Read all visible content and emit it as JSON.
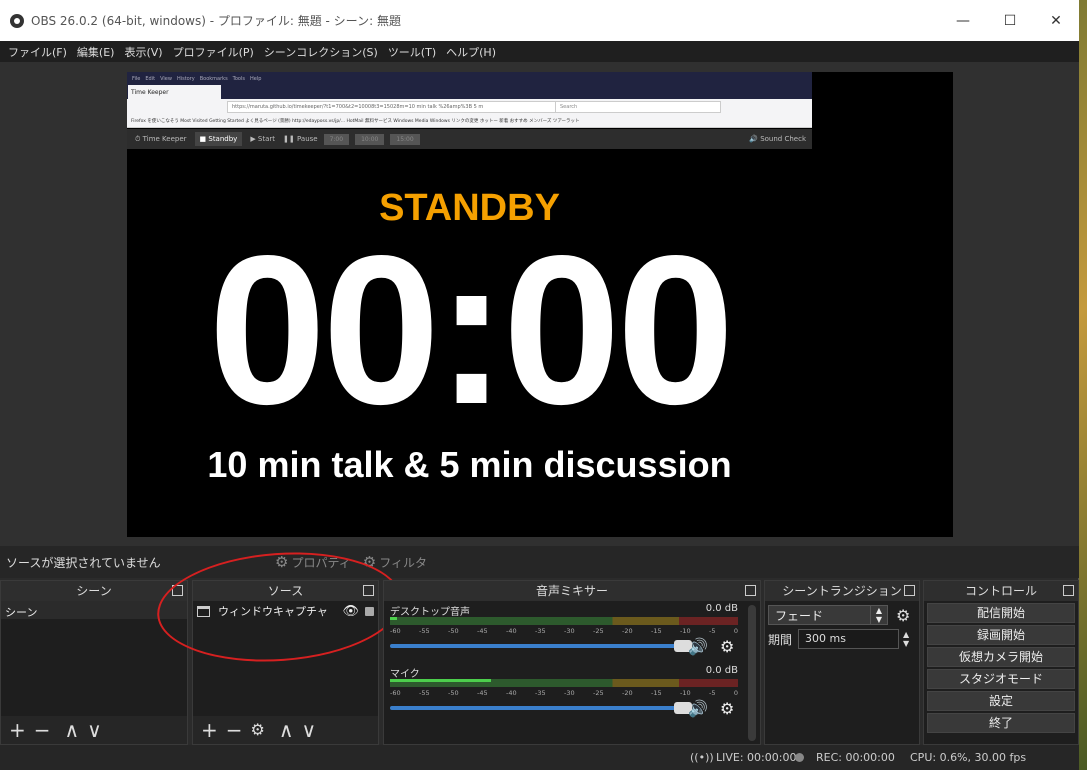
{
  "window": {
    "title": "OBS 26.0.2 (64-bit, windows) - プロファイル: 無題 - シーン: 無題",
    "minimize": "—",
    "maximize": "☐",
    "close": "✕"
  },
  "menu": [
    "ファイル(F)",
    "編集(E)",
    "表示(V)",
    "プロファイル(P)",
    "シーンコレクション(S)",
    "ツール(T)",
    "ヘルプ(H)"
  ],
  "preview": {
    "browser": {
      "menu": [
        "File",
        "Edit",
        "View",
        "History",
        "Bookmarks",
        "Tools",
        "Help"
      ],
      "tab": "Time Keeper",
      "url": "https://maruta.github.io/timekeeper/?t1=700&t2=10008t3=15028m=10 min talk %26amp%3B 5 m",
      "search_placeholder": "Search",
      "bookmarks": "Firefox を使いこなそう  Most Visited  Getting Started  よく見るページ  (景勝)  http://edayposs.vs/jp/...  HotMail 無料サービス  Windows Media  Windows  リンクの変更  ホットー  新着  おすすめ  メンバーズ  ツアーラット"
    },
    "timekeeper": {
      "brand": "⏱ Time Keeper",
      "standby": "■ Standby",
      "start": "▶ Start",
      "pause": "❚❚ Pause",
      "t1": "7:00",
      "t2": "10:00",
      "t3": "15:00",
      "sound": "🔊 Sound Check"
    },
    "status_text": "STANDBY",
    "clock": "00:00",
    "caption": "10 min talk & 5 min discussion"
  },
  "source_toolbar": {
    "no_source": "ソースが選択されていません",
    "properties": "プロパティ",
    "filters": "フィルタ"
  },
  "docks": {
    "scenes": {
      "title": "シーン",
      "items": [
        "シーン"
      ]
    },
    "sources": {
      "title": "ソース",
      "items": [
        "ウィンドウキャプチャ"
      ]
    },
    "mixer": {
      "title": "音声ミキサー",
      "channels": [
        {
          "name": "デスクトップ音声",
          "db": "0.0 dB",
          "level": 0.02
        },
        {
          "name": "マイク",
          "db": "0.0 dB",
          "level": 0.29
        }
      ],
      "ticks": [
        "-60",
        "-55",
        "-50",
        "-45",
        "-40",
        "-35",
        "-30",
        "-25",
        "-20",
        "-15",
        "-10",
        "-5",
        "0"
      ]
    },
    "transitions": {
      "title": "シーントランジション",
      "selected": "フェード",
      "duration_label": "期間",
      "duration": "300 ms"
    },
    "controls": {
      "title": "コントロール",
      "buttons": [
        "配信開始",
        "録画開始",
        "仮想カメラ開始",
        "スタジオモード",
        "設定",
        "終了"
      ]
    }
  },
  "statusbar": {
    "live": "LIVE: 00:00:00",
    "rec": "REC: 00:00:00",
    "cpu": "CPU: 0.6%, 30.00 fps"
  },
  "colors": {
    "accent": "#f5a000",
    "annotation": "#d62020",
    "volume": "#3a7fcc"
  }
}
